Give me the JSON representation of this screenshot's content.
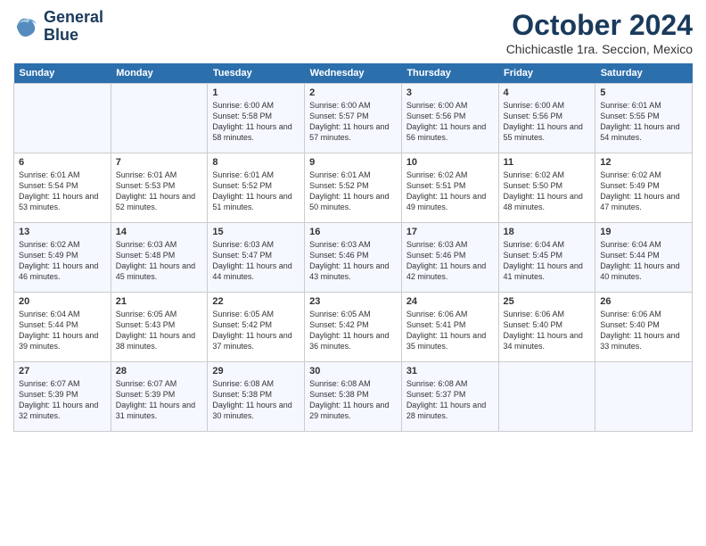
{
  "header": {
    "logo_line1": "General",
    "logo_line2": "Blue",
    "month": "October 2024",
    "location": "Chichicastle 1ra. Seccion, Mexico"
  },
  "days": [
    "Sunday",
    "Monday",
    "Tuesday",
    "Wednesday",
    "Thursday",
    "Friday",
    "Saturday"
  ],
  "weeks": [
    [
      {
        "date": "",
        "sunrise": "",
        "sunset": "",
        "daylight": ""
      },
      {
        "date": "",
        "sunrise": "",
        "sunset": "",
        "daylight": ""
      },
      {
        "date": "1",
        "sunrise": "Sunrise: 6:00 AM",
        "sunset": "Sunset: 5:58 PM",
        "daylight": "Daylight: 11 hours and 58 minutes."
      },
      {
        "date": "2",
        "sunrise": "Sunrise: 6:00 AM",
        "sunset": "Sunset: 5:57 PM",
        "daylight": "Daylight: 11 hours and 57 minutes."
      },
      {
        "date": "3",
        "sunrise": "Sunrise: 6:00 AM",
        "sunset": "Sunset: 5:56 PM",
        "daylight": "Daylight: 11 hours and 56 minutes."
      },
      {
        "date": "4",
        "sunrise": "Sunrise: 6:00 AM",
        "sunset": "Sunset: 5:56 PM",
        "daylight": "Daylight: 11 hours and 55 minutes."
      },
      {
        "date": "5",
        "sunrise": "Sunrise: 6:01 AM",
        "sunset": "Sunset: 5:55 PM",
        "daylight": "Daylight: 11 hours and 54 minutes."
      }
    ],
    [
      {
        "date": "6",
        "sunrise": "Sunrise: 6:01 AM",
        "sunset": "Sunset: 5:54 PM",
        "daylight": "Daylight: 11 hours and 53 minutes."
      },
      {
        "date": "7",
        "sunrise": "Sunrise: 6:01 AM",
        "sunset": "Sunset: 5:53 PM",
        "daylight": "Daylight: 11 hours and 52 minutes."
      },
      {
        "date": "8",
        "sunrise": "Sunrise: 6:01 AM",
        "sunset": "Sunset: 5:52 PM",
        "daylight": "Daylight: 11 hours and 51 minutes."
      },
      {
        "date": "9",
        "sunrise": "Sunrise: 6:01 AM",
        "sunset": "Sunset: 5:52 PM",
        "daylight": "Daylight: 11 hours and 50 minutes."
      },
      {
        "date": "10",
        "sunrise": "Sunrise: 6:02 AM",
        "sunset": "Sunset: 5:51 PM",
        "daylight": "Daylight: 11 hours and 49 minutes."
      },
      {
        "date": "11",
        "sunrise": "Sunrise: 6:02 AM",
        "sunset": "Sunset: 5:50 PM",
        "daylight": "Daylight: 11 hours and 48 minutes."
      },
      {
        "date": "12",
        "sunrise": "Sunrise: 6:02 AM",
        "sunset": "Sunset: 5:49 PM",
        "daylight": "Daylight: 11 hours and 47 minutes."
      }
    ],
    [
      {
        "date": "13",
        "sunrise": "Sunrise: 6:02 AM",
        "sunset": "Sunset: 5:49 PM",
        "daylight": "Daylight: 11 hours and 46 minutes."
      },
      {
        "date": "14",
        "sunrise": "Sunrise: 6:03 AM",
        "sunset": "Sunset: 5:48 PM",
        "daylight": "Daylight: 11 hours and 45 minutes."
      },
      {
        "date": "15",
        "sunrise": "Sunrise: 6:03 AM",
        "sunset": "Sunset: 5:47 PM",
        "daylight": "Daylight: 11 hours and 44 minutes."
      },
      {
        "date": "16",
        "sunrise": "Sunrise: 6:03 AM",
        "sunset": "Sunset: 5:46 PM",
        "daylight": "Daylight: 11 hours and 43 minutes."
      },
      {
        "date": "17",
        "sunrise": "Sunrise: 6:03 AM",
        "sunset": "Sunset: 5:46 PM",
        "daylight": "Daylight: 11 hours and 42 minutes."
      },
      {
        "date": "18",
        "sunrise": "Sunrise: 6:04 AM",
        "sunset": "Sunset: 5:45 PM",
        "daylight": "Daylight: 11 hours and 41 minutes."
      },
      {
        "date": "19",
        "sunrise": "Sunrise: 6:04 AM",
        "sunset": "Sunset: 5:44 PM",
        "daylight": "Daylight: 11 hours and 40 minutes."
      }
    ],
    [
      {
        "date": "20",
        "sunrise": "Sunrise: 6:04 AM",
        "sunset": "Sunset: 5:44 PM",
        "daylight": "Daylight: 11 hours and 39 minutes."
      },
      {
        "date": "21",
        "sunrise": "Sunrise: 6:05 AM",
        "sunset": "Sunset: 5:43 PM",
        "daylight": "Daylight: 11 hours and 38 minutes."
      },
      {
        "date": "22",
        "sunrise": "Sunrise: 6:05 AM",
        "sunset": "Sunset: 5:42 PM",
        "daylight": "Daylight: 11 hours and 37 minutes."
      },
      {
        "date": "23",
        "sunrise": "Sunrise: 6:05 AM",
        "sunset": "Sunset: 5:42 PM",
        "daylight": "Daylight: 11 hours and 36 minutes."
      },
      {
        "date": "24",
        "sunrise": "Sunrise: 6:06 AM",
        "sunset": "Sunset: 5:41 PM",
        "daylight": "Daylight: 11 hours and 35 minutes."
      },
      {
        "date": "25",
        "sunrise": "Sunrise: 6:06 AM",
        "sunset": "Sunset: 5:40 PM",
        "daylight": "Daylight: 11 hours and 34 minutes."
      },
      {
        "date": "26",
        "sunrise": "Sunrise: 6:06 AM",
        "sunset": "Sunset: 5:40 PM",
        "daylight": "Daylight: 11 hours and 33 minutes."
      }
    ],
    [
      {
        "date": "27",
        "sunrise": "Sunrise: 6:07 AM",
        "sunset": "Sunset: 5:39 PM",
        "daylight": "Daylight: 11 hours and 32 minutes."
      },
      {
        "date": "28",
        "sunrise": "Sunrise: 6:07 AM",
        "sunset": "Sunset: 5:39 PM",
        "daylight": "Daylight: 11 hours and 31 minutes."
      },
      {
        "date": "29",
        "sunrise": "Sunrise: 6:08 AM",
        "sunset": "Sunset: 5:38 PM",
        "daylight": "Daylight: 11 hours and 30 minutes."
      },
      {
        "date": "30",
        "sunrise": "Sunrise: 6:08 AM",
        "sunset": "Sunset: 5:38 PM",
        "daylight": "Daylight: 11 hours and 29 minutes."
      },
      {
        "date": "31",
        "sunrise": "Sunrise: 6:08 AM",
        "sunset": "Sunset: 5:37 PM",
        "daylight": "Daylight: 11 hours and 28 minutes."
      },
      {
        "date": "",
        "sunrise": "",
        "sunset": "",
        "daylight": ""
      },
      {
        "date": "",
        "sunrise": "",
        "sunset": "",
        "daylight": ""
      }
    ]
  ]
}
